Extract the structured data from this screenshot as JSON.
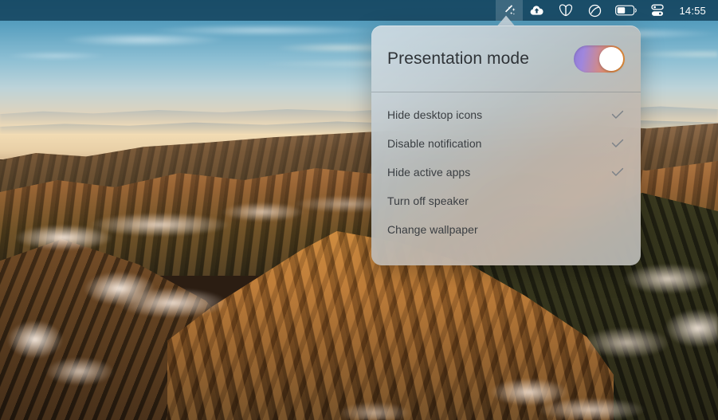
{
  "menubar": {
    "icons": [
      {
        "name": "magic-wand-icon",
        "label": "Presentation mode"
      },
      {
        "name": "cloud-upload-icon",
        "label": "Cloud upload"
      },
      {
        "name": "butterfly-icon",
        "label": "Butterfly"
      },
      {
        "name": "do-not-disturb-icon",
        "label": "Do not disturb"
      },
      {
        "name": "battery-icon",
        "label": "Battery"
      },
      {
        "name": "control-center-icon",
        "label": "Control Center"
      }
    ],
    "clock": "14:55"
  },
  "popover": {
    "title": "Presentation mode",
    "toggle": {
      "state": "on",
      "gradient_start": "#8f7bd8",
      "gradient_end": "#f59a3e",
      "knob_color": "#ffffff"
    },
    "items": [
      {
        "label": "Hide desktop icons",
        "checked": true
      },
      {
        "label": "Disable notification",
        "checked": true
      },
      {
        "label": "Hide active apps",
        "checked": true
      },
      {
        "label": "Turn off speaker",
        "checked": false
      },
      {
        "label": "Change wallpaper",
        "checked": false
      }
    ],
    "check_color": "#7c8288"
  },
  "desktop": {
    "wallpaper_description": "Sunset mountain ridges with low clouds",
    "sky_color": "#59a0c0",
    "menubar_color": "#15445e"
  }
}
